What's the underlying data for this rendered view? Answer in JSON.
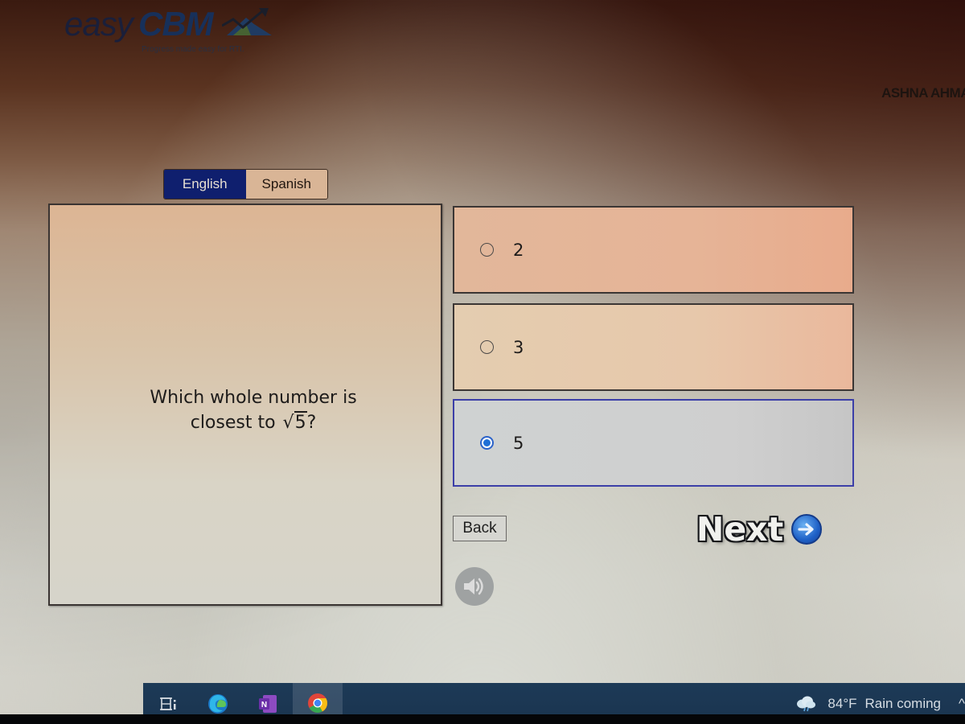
{
  "header": {
    "logo_prefix": "easy",
    "logo_brand": "CBM",
    "tagline": "Progress made easy for RTI.",
    "user_name": "ASHNA AHMA"
  },
  "language_toggle": {
    "options": [
      {
        "label": "English",
        "active": true
      },
      {
        "label": "Spanish",
        "active": false
      }
    ]
  },
  "question": {
    "line1": "Which whole number is",
    "line2_prefix": "closest to ",
    "radical_symbol": "√",
    "radicand": "5",
    "suffix": "?"
  },
  "answers": [
    {
      "label": "2",
      "selected": false
    },
    {
      "label": "3",
      "selected": false
    },
    {
      "label": "5",
      "selected": true
    }
  ],
  "navigation": {
    "back_label": "Back",
    "next_label": "Next",
    "next_icon": "arrow-right-circle-icon",
    "audio_icon": "speaker-icon"
  },
  "colors": {
    "english_active_bg": "#0f1f6e",
    "selected_border": "#3c3fa8",
    "radio_checked": "#1f6fd6",
    "taskbar_bg": "#1d3a57"
  },
  "taskbar": {
    "apps": [
      {
        "name": "task-view",
        "icon": "task-view-icon"
      },
      {
        "name": "edge",
        "icon": "edge-icon"
      },
      {
        "name": "onenote",
        "icon": "onenote-icon",
        "letter": "N"
      },
      {
        "name": "chrome",
        "icon": "chrome-icon",
        "active": true
      }
    ],
    "weather": {
      "temperature": "84°F",
      "condition": "Rain coming",
      "icon": "rain-cloud-icon"
    },
    "tray_chevron": "^"
  }
}
